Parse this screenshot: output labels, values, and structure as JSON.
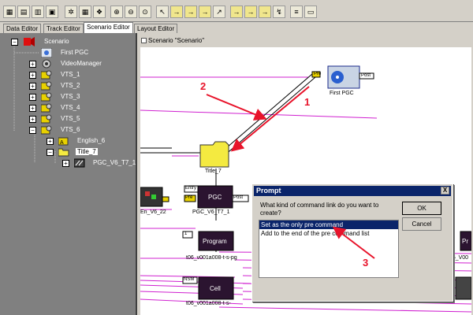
{
  "toolbar": {
    "buttons": [
      {
        "icon": "data-view-icon"
      },
      {
        "icon": "track-view-icon"
      },
      {
        "icon": "scenario-view-icon"
      },
      {
        "icon": "layout-view-icon"
      },
      {
        "icon": "gear-icon"
      },
      {
        "icon": "grid-icon"
      },
      {
        "icon": "palette-icon"
      },
      {
        "icon": "zoom-in-icon"
      },
      {
        "icon": "zoom-out-icon"
      },
      {
        "icon": "zoom-fit-icon"
      },
      {
        "icon": "pointer-icon"
      },
      {
        "icon": "link-pre-icon"
      },
      {
        "icon": "link-post-icon"
      },
      {
        "icon": "link-cell-icon"
      },
      {
        "icon": "link-button-icon"
      },
      {
        "icon": "link-entry-icon"
      },
      {
        "icon": "link-jump-icon"
      },
      {
        "icon": "link-call-icon"
      },
      {
        "icon": "link-exit-icon"
      },
      {
        "icon": "link-navigation-icon"
      },
      {
        "icon": "monitor-icon"
      },
      {
        "icon": "properties-icon"
      }
    ]
  },
  "tabs": [
    {
      "label": "Data Editor"
    },
    {
      "label": "Track Editor"
    },
    {
      "label": "Scenario Editor",
      "active": true
    },
    {
      "label": "Layout Editor"
    }
  ],
  "tree": {
    "items": [
      {
        "label": "Scenario",
        "expander": "−"
      },
      {
        "label": "First PGC",
        "expander": ""
      },
      {
        "label": "VideoManager",
        "expander": "+"
      },
      {
        "label": "VTS_1",
        "expander": "+"
      },
      {
        "label": "VTS_2",
        "expander": "+"
      },
      {
        "label": "VTS_3",
        "expander": "+"
      },
      {
        "label": "VTS_4",
        "expander": "+"
      },
      {
        "label": "VTS_5",
        "expander": "+"
      },
      {
        "label": "VTS_6",
        "expander": "−"
      },
      {
        "label": "English_6",
        "expander": "+"
      },
      {
        "label": "Title_7",
        "expander": "−"
      },
      {
        "label": "PGC_V6_T7_1",
        "expander": "+"
      }
    ]
  },
  "canvas": {
    "title": "Scenario \"Scenario\"",
    "nodes": {
      "pre_label": "Pre",
      "post_label": "Post",
      "first_pgc_label": "First PGC",
      "title_label": "Title_7",
      "entry_label": "Entry",
      "pgc_box_label": "PGC",
      "pgc_label": "PGC_V6_T7_1",
      "pgc_pre_label": "Pre",
      "pgc_post_label": "Post",
      "left_thumb_label": "En_V6_22",
      "program_box_label": "Program",
      "program_number": "1",
      "program_label": "t06_v001a008-t-s-pg",
      "nsm_label": "NSM",
      "cell_box_label": "Cell",
      "cell_label": "t06_v001a008-t-s-",
      "right_label": "t06_V00",
      "right_box_label": "Pr"
    }
  },
  "dialog": {
    "title": "Prompt",
    "close_label": "X",
    "question": "What kind of command link do you want to create?",
    "options": [
      {
        "label": "Set as the only pre command",
        "selected": true
      },
      {
        "label": "Add to the end of the pre command list",
        "selected": false
      }
    ],
    "ok_label": "OK",
    "cancel_label": "Cancel"
  },
  "annotations": {
    "num1": "1",
    "num2": "2",
    "num3": "3",
    "color": "#e8132a"
  }
}
